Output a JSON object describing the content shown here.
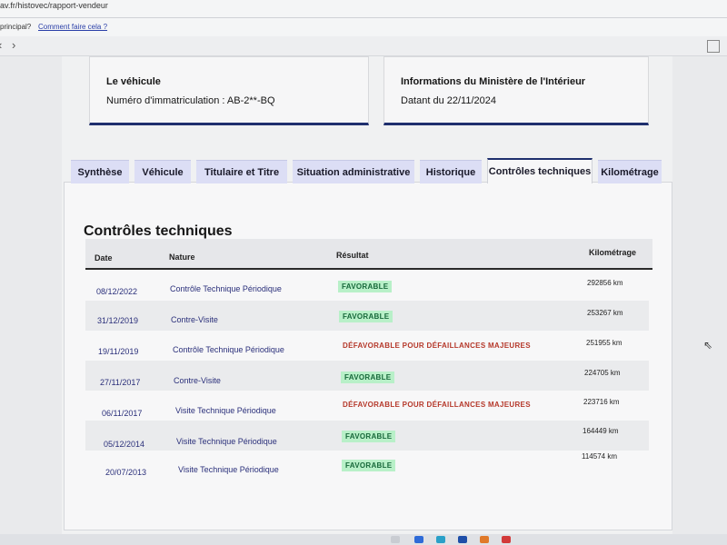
{
  "browser": {
    "url": "av.fr/histovec/rapport-vendeur",
    "bookmark_question": "principal?",
    "bookmark_link": "Comment faire cela ?",
    "back_icon": "chevron-left-icon",
    "forward_icon": "chevron-right-icon"
  },
  "cards": [
    {
      "title": "Le véhicule",
      "value": "Numéro d'immatriculation : AB-2**-BQ"
    },
    {
      "title": "Informations du Ministère de l'Intérieur",
      "value": "Datant du 22/11/2024"
    }
  ],
  "tabs": [
    {
      "label": "Synthèse",
      "active": false
    },
    {
      "label": "Véhicule",
      "active": false
    },
    {
      "label": "Titulaire et Titre",
      "active": false
    },
    {
      "label": "Situation administrative",
      "active": false
    },
    {
      "label": "Historique",
      "active": false
    },
    {
      "label": "Contrôles techniques",
      "active": true
    },
    {
      "label": "Kilométrage",
      "active": false
    }
  ],
  "section": {
    "title": "Contrôles techniques",
    "columns": [
      "Date",
      "Nature",
      "Résultat",
      "Kilométrage"
    ],
    "rows": [
      {
        "date": "08/12/2022",
        "nature": "Contrôle Technique Périodique",
        "result": "FAVORABLE",
        "status": "ok",
        "km": "292856 km"
      },
      {
        "date": "31/12/2019",
        "nature": "Contre-Visite",
        "result": "FAVORABLE",
        "status": "ok",
        "km": "253267 km"
      },
      {
        "date": "19/11/2019",
        "nature": "Contrôle Technique Périodique",
        "result": "DÉFAVORABLE POUR DÉFAILLANCES MAJEURES",
        "status": "ko",
        "km": "251955 km"
      },
      {
        "date": "27/11/2017",
        "nature": "Contre-Visite",
        "result": "FAVORABLE",
        "status": "ok",
        "km": "224705 km"
      },
      {
        "date": "06/11/2017",
        "nature": "Visite Technique Périodique",
        "result": "DÉFAVORABLE POUR DÉFAILLANCES MAJEURES",
        "status": "ko",
        "km": "223716 km"
      },
      {
        "date": "05/12/2014",
        "nature": "Visite Technique Périodique",
        "result": "FAVORABLE",
        "status": "ok",
        "km": "164449 km"
      },
      {
        "date": "20/07/2013",
        "nature": "Visite Technique Périodique",
        "result": "FAVORABLE",
        "status": "ok",
        "km": "114574 km"
      }
    ]
  },
  "colors": {
    "accent": "#1f2f6e",
    "favorable_bg": "#b8f0c8",
    "favorable_text": "#17683a",
    "defavorable_text": "#b5382a",
    "tab_bg": "#dcdef5"
  }
}
